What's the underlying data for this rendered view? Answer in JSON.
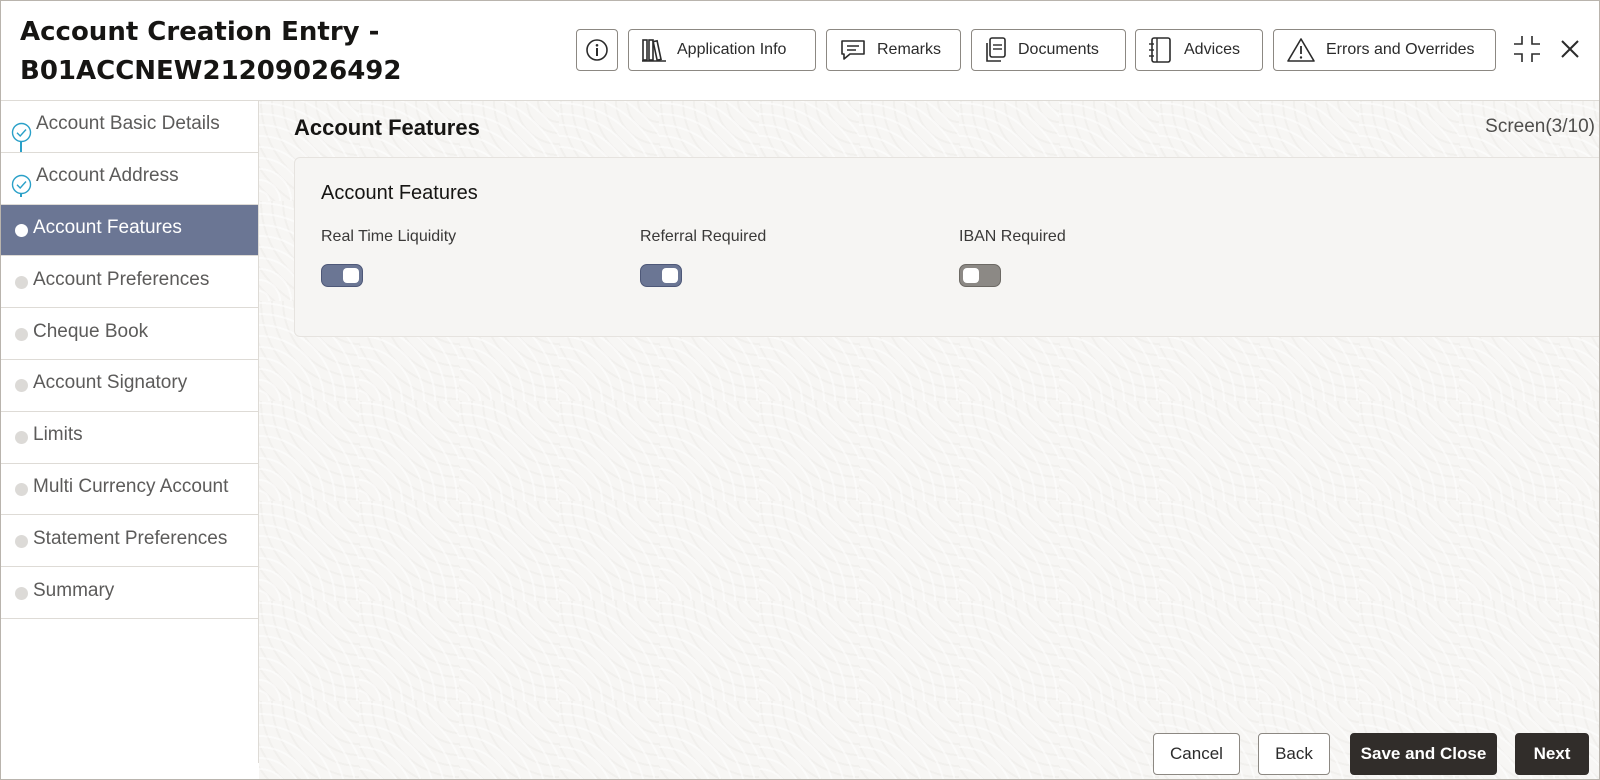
{
  "header": {
    "title_line1": "Account Creation Entry -",
    "title_line2": "B01ACCNEW21209026492",
    "buttons": {
      "application_info": "Application Info",
      "remarks": "Remarks",
      "documents": "Documents",
      "advices": "Advices",
      "errors_overrides": "Errors and Overrides"
    }
  },
  "sidebar": {
    "items": [
      {
        "label": "Account Basic Details",
        "state": "completed"
      },
      {
        "label": "Account Address",
        "state": "completed"
      },
      {
        "label": "Account Features",
        "state": "active"
      },
      {
        "label": "Account Preferences",
        "state": "pending"
      },
      {
        "label": "Cheque Book",
        "state": "pending"
      },
      {
        "label": "Account Signatory",
        "state": "pending"
      },
      {
        "label": "Limits",
        "state": "pending"
      },
      {
        "label": "Multi Currency Account",
        "state": "pending"
      },
      {
        "label": "Statement Preferences",
        "state": "pending"
      },
      {
        "label": "Summary",
        "state": "pending"
      }
    ]
  },
  "main": {
    "section_title": "Account Features",
    "screen_counter": "Screen(3/10)",
    "card": {
      "title": "Account Features",
      "fields": [
        {
          "label": "Real Time Liquidity",
          "value": true
        },
        {
          "label": "Referral Required",
          "value": true
        },
        {
          "label": "IBAN Required",
          "value": false
        }
      ]
    }
  },
  "footer": {
    "cancel": "Cancel",
    "back": "Back",
    "save_close": "Save and Close",
    "next": "Next"
  },
  "colors": {
    "accent": "#6b7694",
    "primary_button": "#312d2a",
    "progress_line": "#2aa0c8",
    "toggle_off": "#8c8985"
  },
  "icons": [
    "info-icon",
    "application-info-icon",
    "remarks-icon",
    "documents-icon",
    "advices-icon",
    "warning-icon",
    "minimize-icon",
    "close-icon",
    "check-icon"
  ]
}
